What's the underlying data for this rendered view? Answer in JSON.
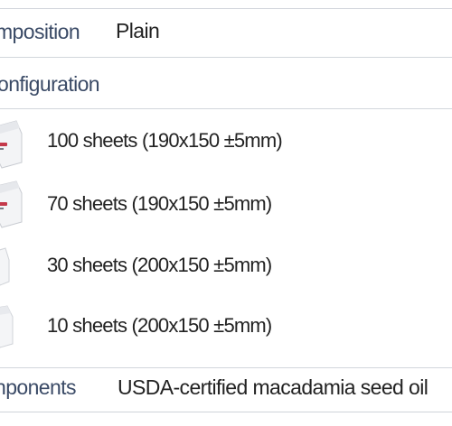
{
  "spec_table": {
    "composition": {
      "label": "mposition",
      "value": "Plain"
    },
    "configuration": {
      "label": "onfiguration",
      "packs": [
        {
          "text": "100 sheets (190x150 ±5mm)",
          "icon": "wet-wipe-pack-icon"
        },
        {
          "text": "70 sheets (190x150 ±5mm)",
          "icon": "wet-wipe-pack-icon"
        },
        {
          "text": "30 sheets (200x150 ±5mm)",
          "icon": "wet-wipe-pack-icon"
        },
        {
          "text": "10 sheets (200x150 ±5mm)",
          "icon": "wet-wipe-pack-icon"
        }
      ]
    },
    "components": {
      "label": "nponents",
      "value": "USDA-certified macadamia seed oil"
    }
  },
  "colors": {
    "label": "#3a4a66",
    "text": "#222222",
    "divider": "#d2d6dc",
    "pack_accent": "#c4394a"
  }
}
